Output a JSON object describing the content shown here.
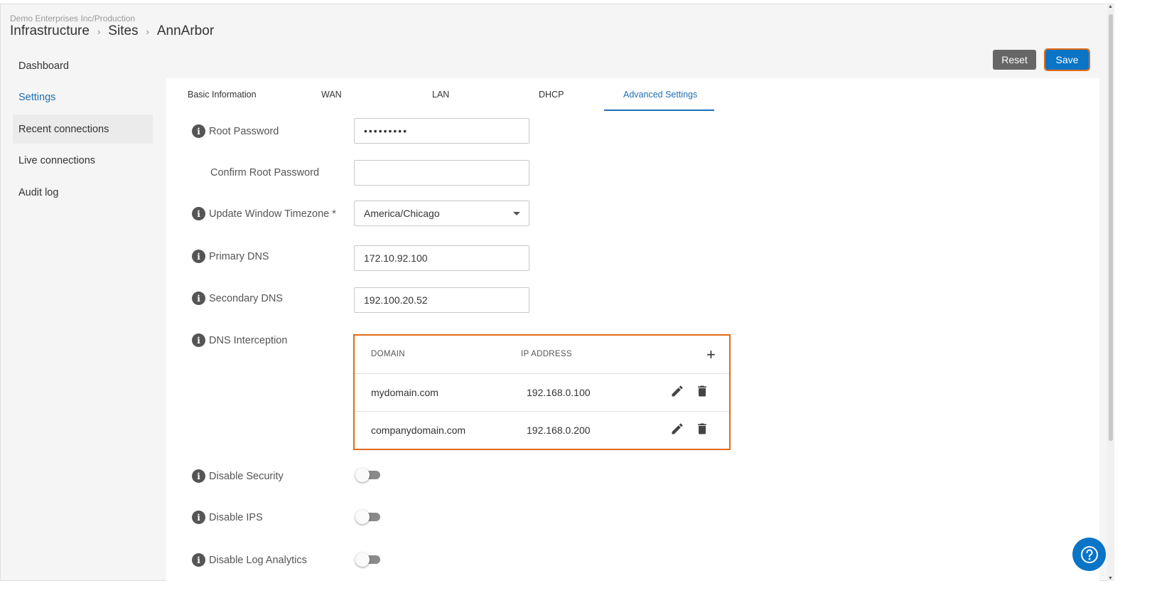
{
  "breadcrumb": {
    "org_path": "Demo Enterprises Inc/Production",
    "items": [
      "Infrastructure",
      "Sites",
      "AnnArbor"
    ],
    "separator": "›"
  },
  "sidebar": {
    "items": [
      {
        "label": "Dashboard"
      },
      {
        "label": "Settings"
      },
      {
        "label": "Recent connections"
      },
      {
        "label": "Live connections"
      },
      {
        "label": "Audit log"
      }
    ]
  },
  "toolbar": {
    "reset_label": "Reset",
    "save_label": "Save"
  },
  "tabs": [
    {
      "label": "Basic Information"
    },
    {
      "label": "WAN"
    },
    {
      "label": "LAN"
    },
    {
      "label": "DHCP"
    },
    {
      "label": "Advanced Settings",
      "active": true
    }
  ],
  "form": {
    "root_password": {
      "label": "Root Password",
      "value": "•••••••••"
    },
    "confirm_root_password": {
      "label": "Confirm Root Password",
      "value": ""
    },
    "timezone": {
      "label": "Update Window Timezone *",
      "value": "America/Chicago"
    },
    "primary_dns": {
      "label": "Primary DNS",
      "value": "172.10.92.100"
    },
    "secondary_dns": {
      "label": "Secondary DNS",
      "value": "192.100.20.52"
    },
    "dns_interception": {
      "label": "DNS Interception",
      "headers": {
        "domain": "DOMAIN",
        "ip": "IP ADDRESS"
      },
      "rows": [
        {
          "domain": "mydomain.com",
          "ip": "192.168.0.100"
        },
        {
          "domain": "companydomain.com",
          "ip": "192.168.0.200"
        }
      ]
    },
    "disable_security": {
      "label": "Disable Security",
      "on": false
    },
    "disable_ips": {
      "label": "Disable IPS",
      "on": false
    },
    "disable_log_analytics": {
      "label": "Disable Log Analytics",
      "on": false
    }
  },
  "icons": {
    "info": "info-icon",
    "add": "plus-icon",
    "edit": "pencil-icon",
    "delete": "trash-icon",
    "help": "help-icon"
  },
  "colors": {
    "accent": "#0a74c6",
    "highlight_border": "#e26a17",
    "reset_button": "#666666",
    "active_text": "#1f6fb2"
  }
}
